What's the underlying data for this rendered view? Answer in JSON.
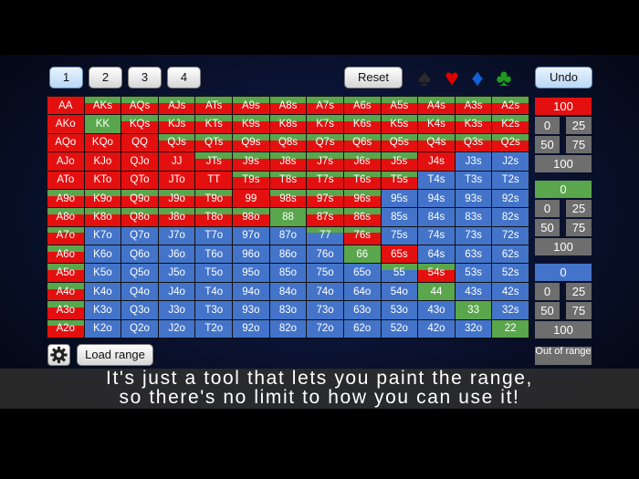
{
  "toolbar": {
    "preset_buttons": [
      "1",
      "2",
      "3",
      "4"
    ],
    "reset_label": "Reset",
    "undo_label": "Undo",
    "suits": [
      {
        "icon": "spade-icon",
        "glyph": "♠",
        "color": "#2b2b2b"
      },
      {
        "icon": "heart-icon",
        "glyph": "♥",
        "color": "#e00000"
      },
      {
        "icon": "diamond-icon",
        "glyph": "♦",
        "color": "#1162d8"
      },
      {
        "icon": "club-icon",
        "glyph": "♣",
        "color": "#1e9a1e"
      }
    ]
  },
  "colors": {
    "red": "#e41010",
    "green": "#5aa64c",
    "blue": "#4374c9"
  },
  "grid": {
    "rows": [
      [
        "AA",
        "AKs",
        "AQs",
        "AJs",
        "ATs",
        "A9s",
        "A8s",
        "A7s",
        "A6s",
        "A5s",
        "A4s",
        "A3s",
        "A2s"
      ],
      [
        "AKo",
        "KK",
        "KQs",
        "KJs",
        "KTs",
        "K9s",
        "K8s",
        "K7s",
        "K6s",
        "K5s",
        "K4s",
        "K3s",
        "K2s"
      ],
      [
        "AQo",
        "KQo",
        "QQ",
        "QJs",
        "QTs",
        "Q9s",
        "Q8s",
        "Q7s",
        "Q6s",
        "Q5s",
        "Q4s",
        "Q3s",
        "Q2s"
      ],
      [
        "AJo",
        "KJo",
        "QJo",
        "JJ",
        "JTs",
        "J9s",
        "J8s",
        "J7s",
        "J6s",
        "J5s",
        "J4s",
        "J3s",
        "J2s"
      ],
      [
        "ATo",
        "KTo",
        "QTo",
        "JTo",
        "TT",
        "T9s",
        "T8s",
        "T7s",
        "T6s",
        "T5s",
        "T4s",
        "T3s",
        "T2s"
      ],
      [
        "A9o",
        "K9o",
        "Q9o",
        "J9o",
        "T9o",
        "99",
        "98s",
        "97s",
        "96s",
        "95s",
        "94s",
        "93s",
        "92s"
      ],
      [
        "A8o",
        "K8o",
        "Q8o",
        "J8o",
        "T8o",
        "98o",
        "88",
        "87s",
        "86s",
        "85s",
        "84s",
        "83s",
        "82s"
      ],
      [
        "A7o",
        "K7o",
        "Q7o",
        "J7o",
        "T7o",
        "97o",
        "87o",
        "77",
        "76s",
        "75s",
        "74s",
        "73s",
        "72s"
      ],
      [
        "A6o",
        "K6o",
        "Q6o",
        "J6o",
        "T6o",
        "96o",
        "86o",
        "76o",
        "66",
        "65s",
        "64s",
        "63s",
        "62s"
      ],
      [
        "A5o",
        "K5o",
        "Q5o",
        "J5o",
        "T5o",
        "95o",
        "85o",
        "75o",
        "65o",
        "55",
        "54s",
        "53s",
        "52s"
      ],
      [
        "A4o",
        "K4o",
        "Q4o",
        "J4o",
        "T4o",
        "94o",
        "84o",
        "74o",
        "64o",
        "54o",
        "44",
        "43s",
        "42s"
      ],
      [
        "A3o",
        "K3o",
        "Q3o",
        "J3o",
        "T3o",
        "93o",
        "83o",
        "73o",
        "63o",
        "53o",
        "43o",
        "33",
        "32s"
      ],
      [
        "A2o",
        "K2o",
        "Q2o",
        "J2o",
        "T2o",
        "92o",
        "82o",
        "72o",
        "62o",
        "52o",
        "42o",
        "32o",
        "22"
      ]
    ],
    "fills": [
      [
        "R",
        "GR",
        "GR",
        "GR",
        "GR",
        "GR",
        "GR",
        "GR",
        "GR",
        "GR",
        "GR",
        "GR",
        "GR"
      ],
      [
        "R",
        "G",
        "GR",
        "GR",
        "GR",
        "GR",
        "GR",
        "GR",
        "GR",
        "GR",
        "GR",
        "GR",
        "GR"
      ],
      [
        "R",
        "R",
        "R",
        "GR",
        "GR",
        "GR",
        "GR",
        "GR",
        "GR",
        "GR",
        "GR",
        "GR",
        "GR"
      ],
      [
        "R",
        "R",
        "R",
        "R",
        "GR",
        "GR",
        "GR",
        "GR",
        "GR",
        "GR",
        "R",
        "B",
        "B"
      ],
      [
        "R",
        "R",
        "R",
        "R",
        "R",
        "GR",
        "GR",
        "GR",
        "GR",
        "GR",
        "B",
        "B",
        "B"
      ],
      [
        "GR",
        "GR",
        "GR",
        "GR",
        "GR",
        "R",
        "GR",
        "GR",
        "GR",
        "B",
        "B",
        "B",
        "B"
      ],
      [
        "GR",
        "GR",
        "GR",
        "GR",
        "GR",
        "GR",
        "G",
        "GR",
        "GR",
        "B",
        "B",
        "B",
        "B"
      ],
      [
        "GR",
        "B",
        "B",
        "B",
        "B",
        "B",
        "B",
        "GB",
        "GR",
        "B",
        "B",
        "B",
        "B"
      ],
      [
        "GR",
        "B",
        "B",
        "B",
        "B",
        "B",
        "B",
        "B",
        "G",
        "R",
        "B",
        "B",
        "B"
      ],
      [
        "GR",
        "B",
        "B",
        "B",
        "B",
        "B",
        "B",
        "B",
        "B",
        "GB",
        "GR",
        "B",
        "B"
      ],
      [
        "GR",
        "B",
        "B",
        "B",
        "B",
        "B",
        "B",
        "B",
        "B",
        "B",
        "G",
        "B",
        "B"
      ],
      [
        "GR",
        "B",
        "B",
        "B",
        "B",
        "B",
        "B",
        "B",
        "B",
        "B",
        "B",
        "G",
        "B"
      ],
      [
        "GR",
        "B",
        "B",
        "B",
        "B",
        "B",
        "B",
        "B",
        "B",
        "B",
        "B",
        "B",
        "G"
      ]
    ]
  },
  "panels": [
    {
      "color": "red",
      "value": "100",
      "options": [
        "0",
        "25",
        "50",
        "75",
        "100"
      ]
    },
    {
      "color": "green",
      "value": "0",
      "options": [
        "0",
        "25",
        "50",
        "75",
        "100"
      ]
    },
    {
      "color": "blue",
      "value": "0",
      "options": [
        "0",
        "25",
        "50",
        "75",
        "100"
      ]
    }
  ],
  "bottom": {
    "load_label": "Load range",
    "out_of_range": "Out of range"
  },
  "caption": {
    "line1": "It's just a tool that lets you paint the range,",
    "line2": "so there's no limit to how you can use it!"
  }
}
